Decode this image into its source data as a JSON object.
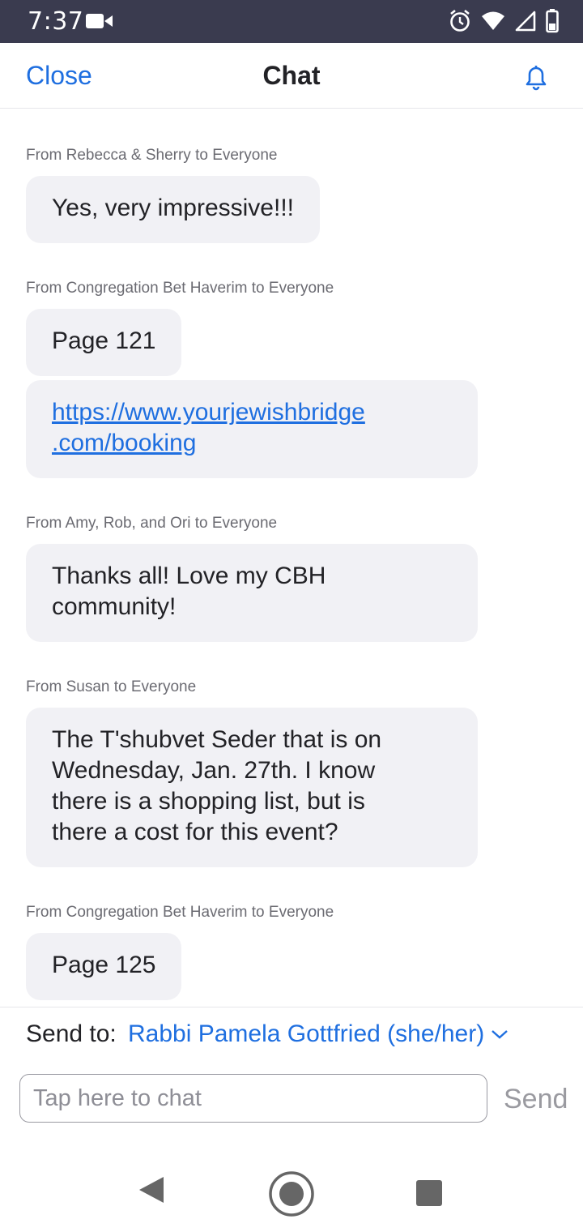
{
  "status_bar": {
    "time": "7:37",
    "icons": [
      "video-camera-icon",
      "alarm-icon",
      "wifi-icon",
      "signal-icon",
      "battery-icon"
    ]
  },
  "header": {
    "close_label": "Close",
    "title": "Chat",
    "bell_icon": "bell-icon"
  },
  "messages": [
    {
      "sender": "From Rebecca & Sherry to Everyone",
      "bubbles": [
        "Yes, very impressive!!!"
      ]
    },
    {
      "sender": "From Congregation Bet Haverim to Everyone",
      "bubbles": [
        "Page 121",
        "https://www.yourjewishbridge.com/booking"
      ]
    },
    {
      "sender": "From Amy, Rob, and Ori to Everyone",
      "bubbles": [
        "Thanks all! Love my CBH community!"
      ]
    },
    {
      "sender": "From Susan to Everyone",
      "bubbles": [
        "The T'shubvet Seder that is on Wednesday, Jan. 27th. I know there is a shopping list, but is there a cost for this event?"
      ]
    },
    {
      "sender": "From Congregation Bet Haverim to Everyone",
      "bubbles": [
        "Page 125"
      ]
    }
  ],
  "link_lines": [
    "https://www.yourjewishbridge",
    ".com/booking"
  ],
  "composer": {
    "send_to_label": "Send to:",
    "send_to_value": "Rabbi Pamela Gottfried (she/her)",
    "input_placeholder": "Tap here to chat",
    "send_label": "Send"
  },
  "colors": {
    "accent": "#1f6fe0",
    "status_bar": "#3a3b4f",
    "bubble": "#f1f1f5"
  }
}
